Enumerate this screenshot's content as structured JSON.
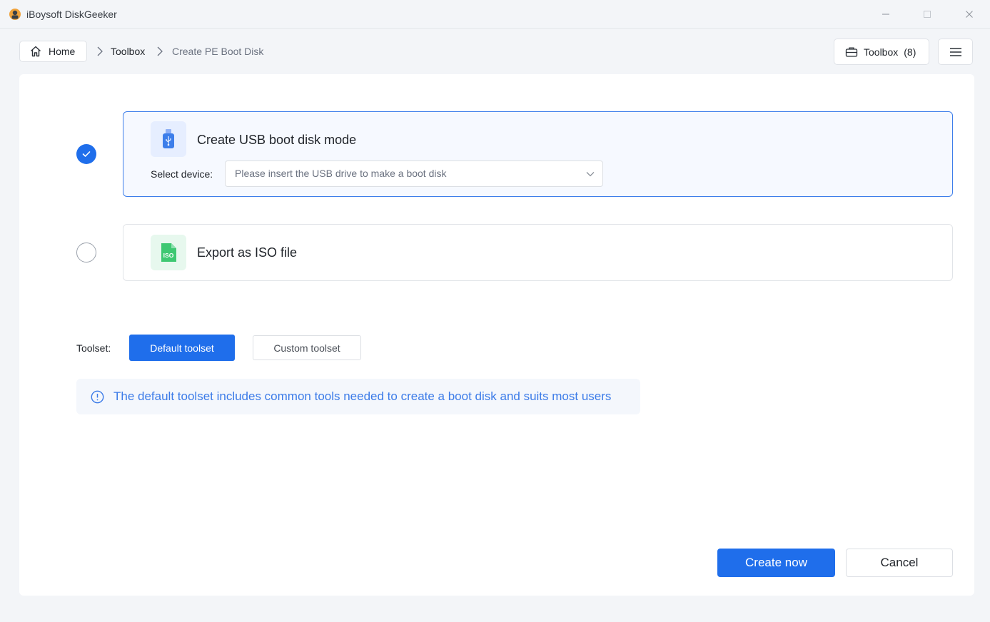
{
  "window": {
    "title": "iBoysoft DiskGeeker"
  },
  "nav": {
    "home_label": "Home",
    "breadcrumb": [
      "Toolbox",
      "Create PE Boot Disk"
    ],
    "toolbox_label": "Toolbox",
    "toolbox_count": "(8)"
  },
  "options": {
    "usb": {
      "title": "Create USB boot disk mode",
      "select_label": "Select device:",
      "select_placeholder": "Please insert the USB drive to make a boot disk",
      "selected": true
    },
    "iso": {
      "title": "Export as ISO file",
      "icon_text": "ISO",
      "selected": false
    }
  },
  "toolset": {
    "label": "Toolset:",
    "default_label": "Default toolset",
    "custom_label": "Custom toolset",
    "info": "The default toolset includes common tools needed to create a boot disk and suits most users"
  },
  "actions": {
    "create_label": "Create now",
    "cancel_label": "Cancel"
  },
  "colors": {
    "primary": "#1f6eeb",
    "info_text": "#3b7be8",
    "iso_green": "#3ec872",
    "usb_icon_bg": "#e6eeff"
  },
  "icons": {
    "app": "iboysoft-logo-icon",
    "home": "home-icon",
    "toolbox": "briefcase-icon",
    "menu": "hamburger-menu-icon",
    "usb": "usb-drive-icon",
    "iso": "iso-file-icon",
    "info": "info-icon",
    "chevron": "chevron-down-icon",
    "check": "check-icon"
  }
}
